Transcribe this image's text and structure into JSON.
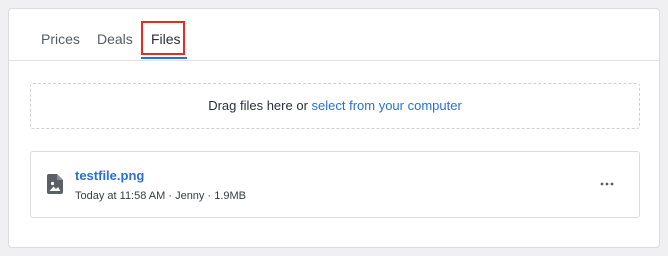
{
  "tabs": [
    {
      "label": "Prices"
    },
    {
      "label": "Deals"
    },
    {
      "label": "Files"
    }
  ],
  "active_tab": "Files",
  "dropzone": {
    "text": "Drag files here or ",
    "link_text": "select from your computer"
  },
  "files": [
    {
      "name": "testfile.png",
      "meta": "Today at 11:58 AM · Jenny · 1.9MB",
      "icon": "image-file-icon"
    }
  ],
  "more_icon": "more-horizontal-icon",
  "colors": {
    "accent": "#2a6fd6",
    "highlight_border": "#e02e24",
    "text": "#2b2f36",
    "muted_text": "#555a63"
  }
}
